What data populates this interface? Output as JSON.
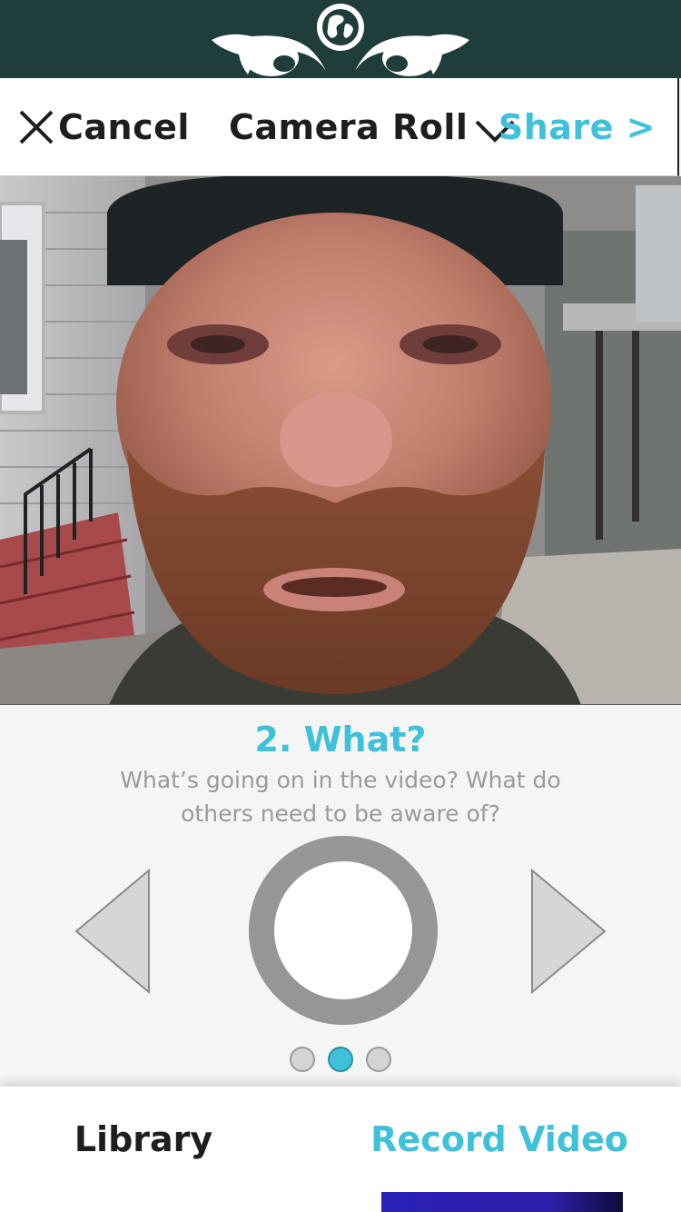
{
  "brand": {
    "logo_icon": "globe-eyes-logo"
  },
  "toolbar": {
    "cancel_label": "Cancel",
    "cancel_icon": "close-icon",
    "source_label": "Camera Roll",
    "source_icon": "chevron-down-icon",
    "share_label": "Share >"
  },
  "video": {
    "description": "video-preview"
  },
  "prompt": {
    "title": "2. What?",
    "description": "What’s going on in the video? What do others need to be aware of?",
    "prev_icon": "triangle-left-icon",
    "next_icon": "triangle-right-icon",
    "record_icon": "record-circle-icon",
    "page_count": 3,
    "active_page": 2
  },
  "tabs": {
    "library_label": "Library",
    "record_label": "Record Video",
    "active_tab": "record"
  },
  "colors": {
    "brand_dark": "#1f3d3a",
    "accent": "#3fc1da",
    "indicator": "#2a1fb8",
    "text_dark": "#1e1e1e",
    "text_muted": "#9a9a9a"
  }
}
